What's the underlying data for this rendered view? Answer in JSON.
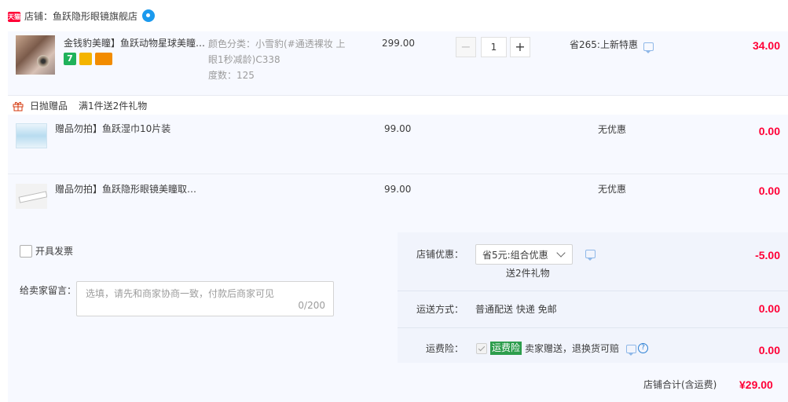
{
  "shop": {
    "badge": "天猫",
    "name": "店铺：鱼跃隐形眼镜旗舰店"
  },
  "item": {
    "title": "金钱豹美瞳】鱼跃动物星球美瞳…",
    "sku_line1": "颜色分类：小雪豹(#通透裸妆 上",
    "sku_line2": "眼1秒减龄)C338",
    "sku_line3": "度数：125",
    "unit_price": "299.00",
    "minus": "−",
    "quantity": "1",
    "plus": "+",
    "promo": "省265:上新特惠",
    "amount": "34.00",
    "service_icon_7": "7",
    "badge_colors": [
      "#20b25b",
      "#f4b400",
      "#f28c00"
    ]
  },
  "gifts": {
    "header_label": "日抛赠品",
    "header_rule": "满1件送2件礼物",
    "items": [
      {
        "title": "赠品勿拍】鱼跃湿巾10片装",
        "price": "99.00",
        "promo": "无优惠",
        "amount": "0.00"
      },
      {
        "title": "赠品勿拍】鱼跃隐形眼镜美瞳取…",
        "price": "99.00",
        "promo": "无优惠",
        "amount": "0.00"
      }
    ]
  },
  "invoice": {
    "label": "开具发票",
    "checked": false
  },
  "message": {
    "label": "给卖家留言：",
    "placeholder": "选填，请先和商家协商一致，付款后商家可见",
    "counter": "0/200"
  },
  "shop_discount": {
    "label": "店铺优惠：",
    "selected": "省5元:组合优惠",
    "note": "送2件礼物",
    "amount": "-5.00"
  },
  "shipping": {
    "label": "运送方式：",
    "value": "普通配送 快递 免邮",
    "amount": "0.00"
  },
  "insurance": {
    "label": "运费险：",
    "badge": "运费险",
    "text": "卖家赠送，退换货可赔",
    "help": "?",
    "amount": "0.00"
  },
  "total": {
    "label": "店铺合计(含运费)",
    "amount": "¥29.00"
  },
  "colors": {
    "price_red": "#ff0036",
    "row_bg": "#f7f9ff",
    "panel_bg": "#f1f4fc",
    "link_blue": "#1b9aee",
    "insurance_green": "#2d9d4c"
  }
}
